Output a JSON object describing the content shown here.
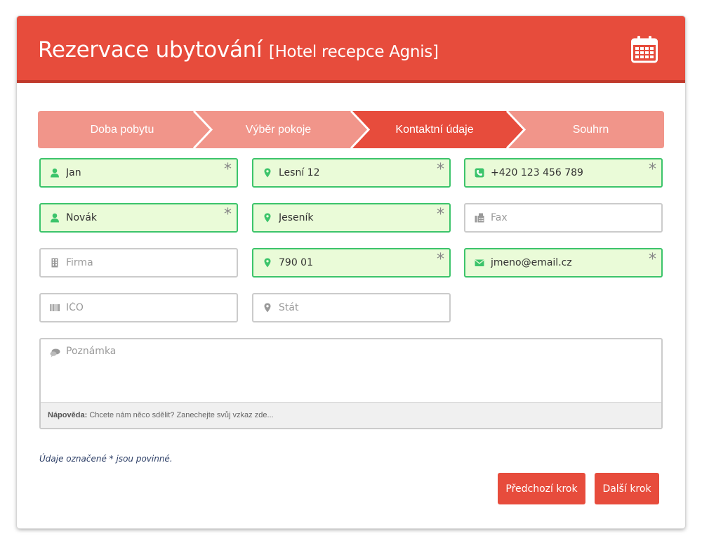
{
  "header": {
    "title": "Rezervace ubytování",
    "subtitle": "[Hotel recepce Agnis]",
    "icon": "calendar-icon"
  },
  "steps": [
    {
      "label": "Doba pobytu",
      "state": "done"
    },
    {
      "label": "Výběr pokoje",
      "state": "done"
    },
    {
      "label": "Kontaktní údaje",
      "state": "active"
    },
    {
      "label": "Souhrn",
      "state": "upcoming"
    }
  ],
  "fields": {
    "first_name": {
      "value": "Jan",
      "placeholder": "",
      "required": "*",
      "icon": "user-icon"
    },
    "last_name": {
      "value": "Novák",
      "placeholder": "",
      "required": "*",
      "icon": "user-icon"
    },
    "company": {
      "value": "",
      "placeholder": "Firma",
      "icon": "building-icon"
    },
    "ico": {
      "value": "",
      "placeholder": "IČO",
      "icon": "barcode-icon"
    },
    "street": {
      "value": "Lesní 12",
      "placeholder": "",
      "required": "*",
      "icon": "map-marker-icon"
    },
    "city": {
      "value": "Jeseník",
      "placeholder": "",
      "required": "*",
      "icon": "map-marker-icon"
    },
    "zip": {
      "value": "790 01",
      "placeholder": "",
      "required": "*",
      "icon": "map-marker-icon"
    },
    "country": {
      "value": "",
      "placeholder": "Stát",
      "icon": "map-marker-icon"
    },
    "phone": {
      "value": "+420 123 456 789",
      "placeholder": "",
      "required": "*",
      "icon": "phone-icon"
    },
    "fax": {
      "value": "",
      "placeholder": "Fax",
      "icon": "fax-icon"
    },
    "email": {
      "value": "jmeno@email.cz",
      "placeholder": "",
      "required": "*",
      "icon": "envelope-icon"
    }
  },
  "note": {
    "placeholder": "Poznámka",
    "icon": "comment-icon",
    "hint_label": "Nápověda:",
    "hint_text": "Chcete nám něco sdělit? Zanechejte svůj vzkaz zde..."
  },
  "required_note": "Údaje označené * jsou povinné.",
  "buttons": {
    "prev": "Předchozí krok",
    "next": "Další krok"
  },
  "colors": {
    "accent": "#e74c3c",
    "step_inactive": "#f1958a",
    "valid_border": "#3cc46b",
    "valid_bg": "#eafbd8"
  }
}
